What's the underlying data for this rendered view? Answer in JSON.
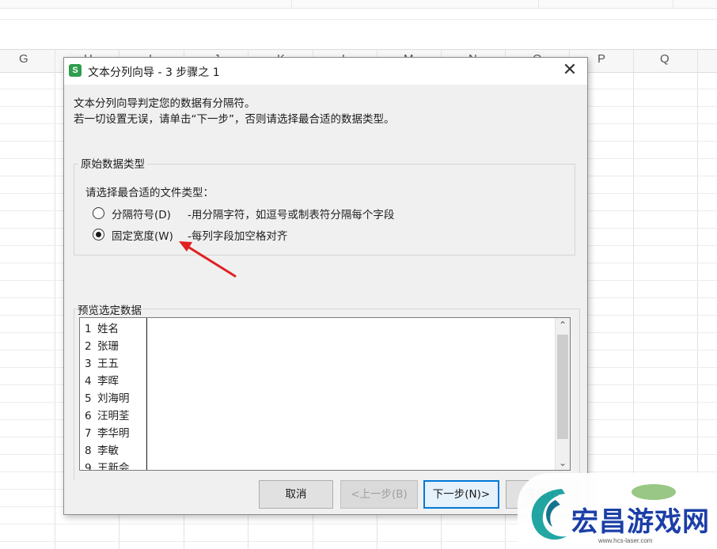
{
  "spreadsheet": {
    "columns": [
      "G",
      "H",
      "I",
      "J",
      "K",
      "L",
      "M",
      "N",
      "O",
      "P",
      "Q"
    ]
  },
  "dialog": {
    "title": "文本分列向导 - 3 步骤之 1",
    "app_icon_letter": "S",
    "close_glyph": "✕",
    "description_line1": "文本分列向导判定您的数据有分隔符。",
    "description_line2": "若一切设置无误，请单击“下一步”，否则请选择最合适的数据类型。",
    "data_type_group": {
      "legend": "原始数据类型",
      "prompt": "请选择最合适的文件类型：",
      "options": [
        {
          "label": "分隔符号(D)",
          "description": "-用分隔字符，如逗号或制表符分隔每个字段",
          "selected": false
        },
        {
          "label": "固定宽度(W)",
          "description": "-每列字段加空格对齐",
          "selected": true
        }
      ]
    },
    "preview": {
      "legend": "预览选定数据",
      "rows": [
        {
          "num": "1",
          "text": "姓名"
        },
        {
          "num": "2",
          "text": "张珊"
        },
        {
          "num": "3",
          "text": "王五"
        },
        {
          "num": "4",
          "text": "李晖"
        },
        {
          "num": "5",
          "text": "刘海明"
        },
        {
          "num": "6",
          "text": "汪明荃"
        },
        {
          "num": "7",
          "text": "李华明"
        },
        {
          "num": "8",
          "text": "李敏"
        },
        {
          "num": "9",
          "text": "王新会"
        }
      ]
    },
    "buttons": {
      "cancel": "取消",
      "back": "<上一步(B)",
      "next": "下一步(N)>",
      "finish": "完成(F)"
    }
  },
  "annotation": {
    "arrow_color": "#e02020"
  },
  "watermark": {
    "text": "宏昌游戏网",
    "url": "www.hcs-laser.com",
    "text_color": "#1b3fa8"
  }
}
